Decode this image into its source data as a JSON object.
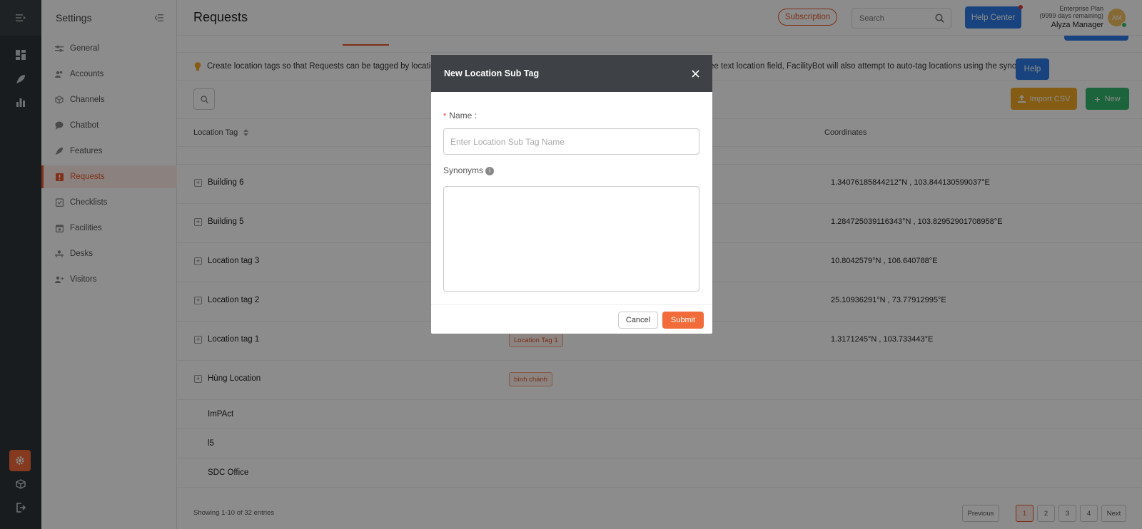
{
  "sidebar": {
    "title": "Settings",
    "items": [
      {
        "label": "General",
        "icon": "sliders-icon"
      },
      {
        "label": "Accounts",
        "icon": "users-icon"
      },
      {
        "label": "Channels",
        "icon": "cube-icon"
      },
      {
        "label": "Chatbot",
        "icon": "chat-icon"
      },
      {
        "label": "Features",
        "icon": "rocket-icon"
      },
      {
        "label": "Requests",
        "icon": "request-icon"
      },
      {
        "label": "Checklists",
        "icon": "checklist-icon"
      },
      {
        "label": "Facilities",
        "icon": "calendar-icon"
      },
      {
        "label": "Desks",
        "icon": "desk-icon"
      },
      {
        "label": "Visitors",
        "icon": "visitor-icon"
      }
    ]
  },
  "header": {
    "title": "Requests",
    "subscription": "Subscription",
    "search_placeholder": "Search",
    "help_center": "Help Center",
    "plan_line1": "Enterprise Plan",
    "plan_line2": "(9999 days remaining)",
    "user_name": "Alyza Manager",
    "avatar_initials": "AM"
  },
  "info": {
    "text": "Create location tags so that Requests can be tagged by location. Th",
    "text_right": "free text location field, FacilityBot will also attempt to auto-tag locations using the synonyms.",
    "help": "Help"
  },
  "toolbar": {
    "import_csv": "Import CSV",
    "new": "New"
  },
  "table": {
    "col_location_tag": "Location Tag",
    "col_coordinates": "Coordinates",
    "rows": [
      {
        "name": "Building 6",
        "tag": "",
        "coord": "1.34076185844212°N , 103.844130599037°E"
      },
      {
        "name": "Building 5",
        "tag": "",
        "coord": "1.284725039116343°N , 103.82952901708958°E"
      },
      {
        "name": "Location tag 3",
        "tag": "",
        "coord": "10.8042579°N , 106.640788°E"
      },
      {
        "name": "Location tag 2",
        "tag": "",
        "coord": "25.10936291°N , 73.77912995°E"
      },
      {
        "name": "Location tag 1",
        "tag": "Location Tag 1",
        "coord": "1.3171245°N , 103.733443°E"
      },
      {
        "name": "Hùng Location",
        "tag": "bình chánh",
        "coord": ""
      }
    ],
    "simple_rows": [
      "ImPAct",
      "l5",
      "SDC Office"
    ],
    "footer": "Showing 1-10 of 32 entries",
    "pagination": [
      "Previous",
      "1",
      "2",
      "3",
      "4",
      "Next"
    ]
  },
  "modal": {
    "title": "New Location Sub Tag",
    "name_label": "Name :",
    "name_placeholder": "Enter Location Sub Tag Name",
    "synonyms_label": "Synonyms",
    "cancel": "Cancel",
    "submit": "Submit"
  },
  "colors": {
    "accent": "#f26b3a",
    "primary_blue": "#2c7be5",
    "import": "#f0a824",
    "new": "#33b66c",
    "rail": "#2f3438"
  }
}
